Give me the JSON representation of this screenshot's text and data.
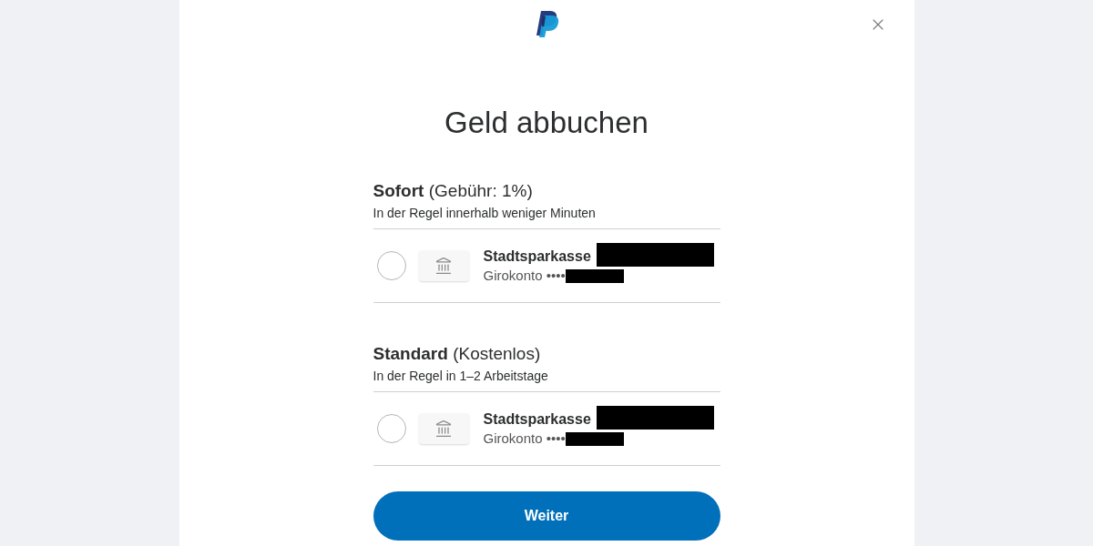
{
  "dialog": {
    "title": "Geld abbuchen"
  },
  "options": [
    {
      "heading": "**Sofort** (Gebühr: 1%)",
      "subtitle": "In der Regel innerhalb weniger Minuten",
      "accounts": [
        {
          "bank": "Stadtsparkasse",
          "bank_redacted": true,
          "type": "Girokonto ••••",
          "number_redacted": true,
          "selected": false
        }
      ]
    },
    {
      "heading": "**Standard** (Kostenlos)",
      "subtitle": "In der Regel in 1–2 Arbeitstage",
      "accounts": [
        {
          "bank": "Stadtsparkasse",
          "bank_redacted": true,
          "type": "Girokonto ••••",
          "number_redacted": true,
          "selected": false
        }
      ]
    }
  ],
  "button": {
    "label": "Weiter"
  }
}
